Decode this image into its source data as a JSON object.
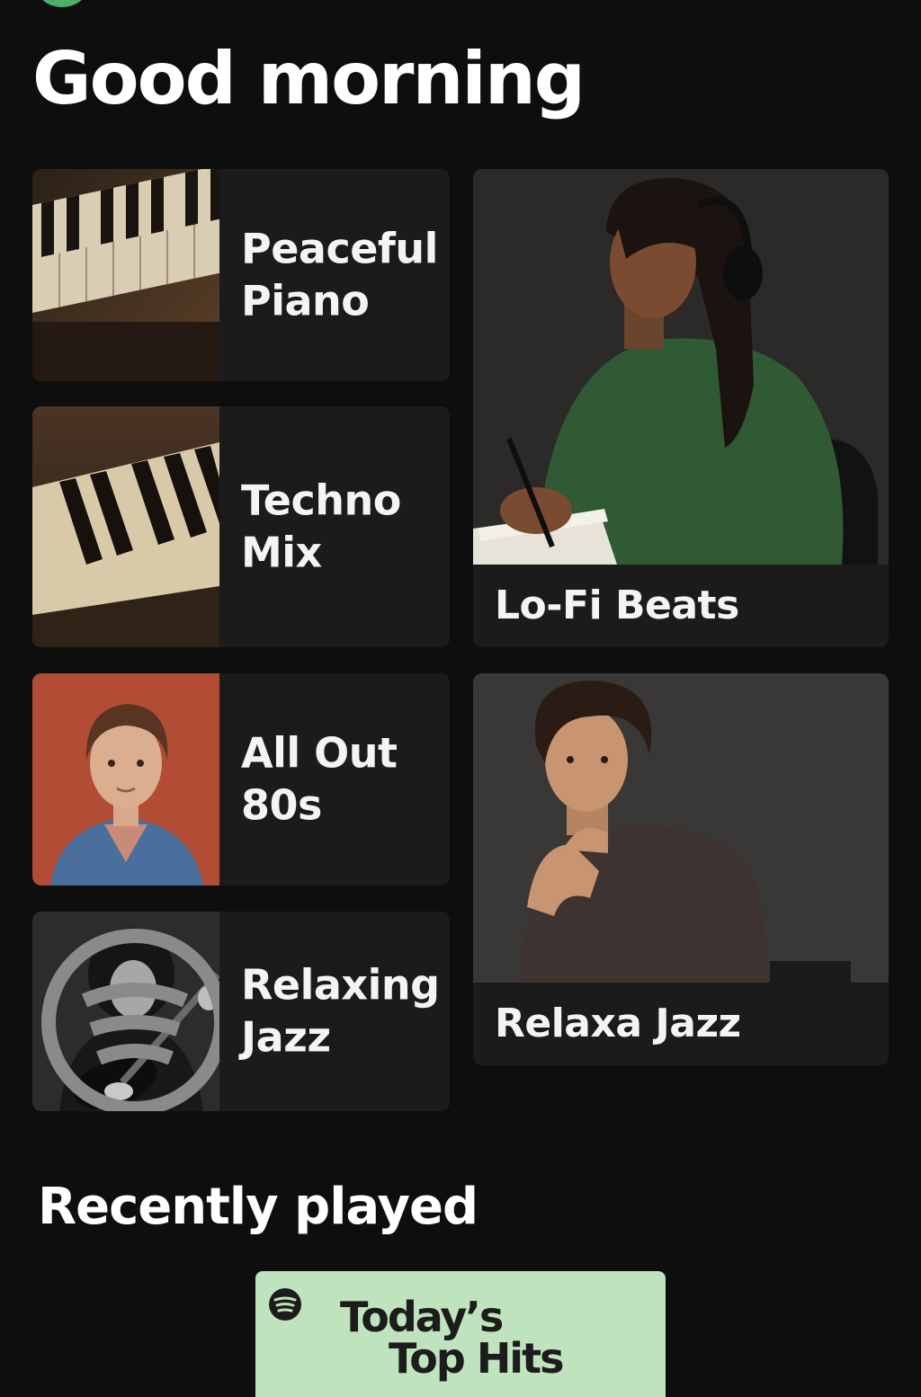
{
  "header": {
    "greeting": "Good morning"
  },
  "tiles": [
    {
      "title": "Peaceful\nPiano",
      "image": "piano-keys-closeup"
    },
    {
      "title": "Techno\nMix",
      "image": "piano-keys-angled"
    },
    {
      "title": "All Out\n80s",
      "image": "portrait-man-denim-jacket"
    },
    {
      "title": "Relaxing\nJazz",
      "image": "guitarist-black-and-white"
    }
  ],
  "feature_tiles": [
    {
      "title": "Lo-Fi Beats",
      "image": "woman-headphones-writing"
    },
    {
      "title": "Relaxa Jazz",
      "image": "man-chin-on-hand"
    }
  ],
  "recently_played": {
    "title": "Recently played",
    "items": [
      {
        "line1": "Today’s",
        "line2": "Top Hits",
        "icon": "spotify-logo-icon"
      }
    ]
  },
  "colors": {
    "background": "#0e0e0e",
    "tile": "#1b1b1b",
    "accent": "#4caf67",
    "card_green": "#bfe3bc"
  }
}
